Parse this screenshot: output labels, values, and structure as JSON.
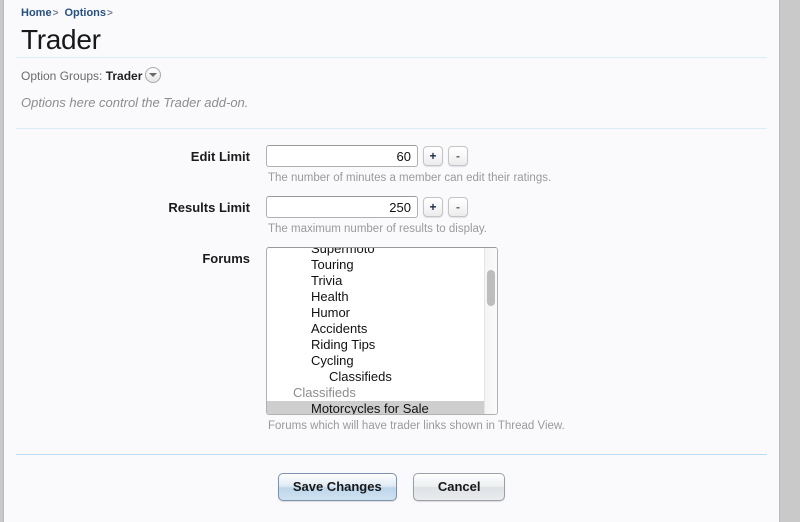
{
  "breadcrumb": {
    "items": [
      {
        "label": "Home",
        "sep": ">"
      },
      {
        "label": "Options",
        "sep": ">"
      }
    ]
  },
  "page": {
    "title": "Trader",
    "option_groups_label": "Option Groups:",
    "option_groups_value": "Trader",
    "dropdown_icon": "chevron-down-circle-icon",
    "description": "Options here control the Trader add-on."
  },
  "form": {
    "fields": [
      {
        "label": "Edit Limit",
        "value": "60",
        "placeholder": "",
        "plus": "+",
        "minus": "-",
        "hint": "The number of minutes a member can edit their ratings."
      },
      {
        "label": "Results Limit",
        "value": "250",
        "placeholder": "",
        "plus": "+",
        "minus": "-",
        "hint": "The maximum number of results to display."
      }
    ],
    "forums": {
      "label": "Forums",
      "hint": "Forums which will have trader links shown in Thread View.",
      "options": [
        {
          "text": "Supermoto",
          "level": 1,
          "group": false,
          "selected": false
        },
        {
          "text": "Touring",
          "level": 1,
          "group": false,
          "selected": false
        },
        {
          "text": "Trivia",
          "level": 1,
          "group": false,
          "selected": false
        },
        {
          "text": "Health",
          "level": 1,
          "group": false,
          "selected": false
        },
        {
          "text": "Humor",
          "level": 1,
          "group": false,
          "selected": false
        },
        {
          "text": "Accidents",
          "level": 1,
          "group": false,
          "selected": false
        },
        {
          "text": "Riding Tips",
          "level": 1,
          "group": false,
          "selected": false
        },
        {
          "text": "Cycling",
          "level": 1,
          "group": false,
          "selected": false
        },
        {
          "text": "Classifieds",
          "level": 2,
          "group": false,
          "selected": false
        },
        {
          "text": "Classifieds",
          "level": 0,
          "group": true,
          "selected": false
        },
        {
          "text": "Motorcycles for Sale",
          "level": 1,
          "group": false,
          "selected": true
        }
      ],
      "scroll_position": "near-top"
    }
  },
  "footer": {
    "save_label": "Save Changes",
    "cancel_label": "Cancel"
  },
  "colors": {
    "page_background": "#fafafd",
    "outer_background": "#c9c9c9",
    "link": "#27507e",
    "rule": "#d9ecf7",
    "rule_strong": "#b8ddf5",
    "hint_text": "#9a9a9a",
    "selected_row": "#cecece",
    "primary_button": "#bed6ea"
  }
}
